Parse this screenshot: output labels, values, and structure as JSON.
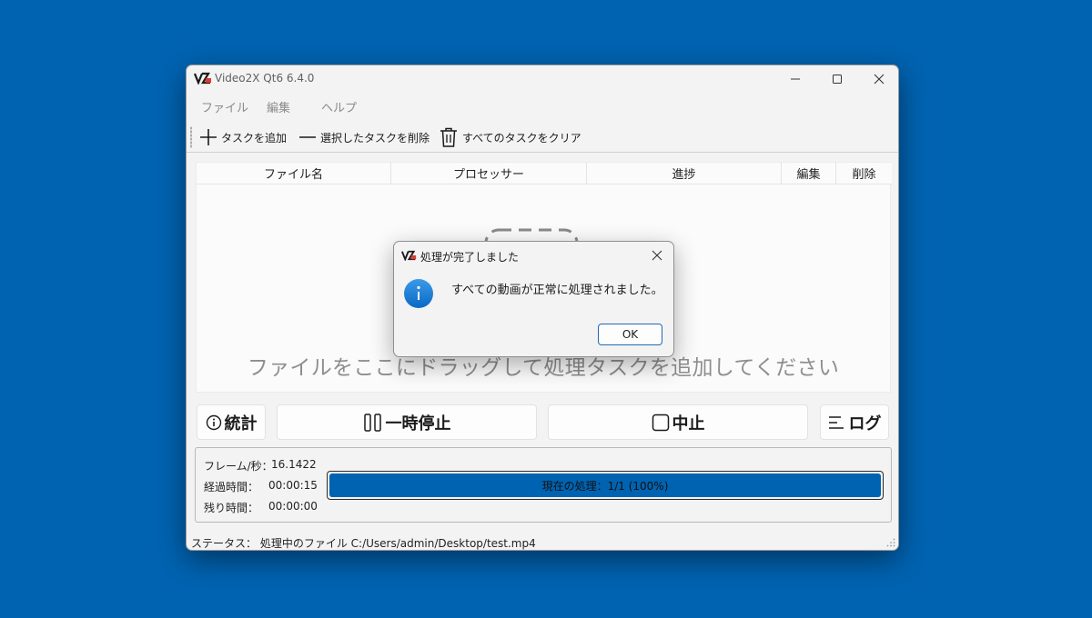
{
  "window": {
    "title": "Video2X Qt6 6.4.0"
  },
  "menu": [
    "ファイル",
    "編集",
    "ヘルプ"
  ],
  "toolbar": {
    "add_task": "タスクを追加",
    "remove_selected": "選択したタスクを削除",
    "clear_all": "すべてのタスクをクリア"
  },
  "table": {
    "columns": [
      "ファイル名",
      "プロセッサー",
      "進捗",
      "編集",
      "削除"
    ],
    "drop_hint": "ファイルをここにドラッグして処理タスクを追加してください"
  },
  "controls": {
    "stats": "統計",
    "pause": "一時停止",
    "abort": "中止",
    "log": "ログ"
  },
  "stats": {
    "fps_label": "フレーム/秒：",
    "fps_value": "16.1422",
    "elapsed_label": "経過時間：",
    "elapsed_value": "00:00:15",
    "remaining_label": "残り時間：",
    "remaining_value": "00:00:00"
  },
  "progress": {
    "text": "現在の処理：1/1 (100%)",
    "percent": 100
  },
  "status": {
    "label": "ステータス：",
    "text": "処理中のファイル C:/Users/admin/Desktop/test.mp4"
  },
  "dialog": {
    "title": "処理が完了しました",
    "message": "すべての動画が正常に処理されました。",
    "ok": "OK"
  },
  "colors": {
    "desktop": "#0063b1",
    "accent": "#0063b1",
    "window_bg": "#f3f3f3"
  }
}
